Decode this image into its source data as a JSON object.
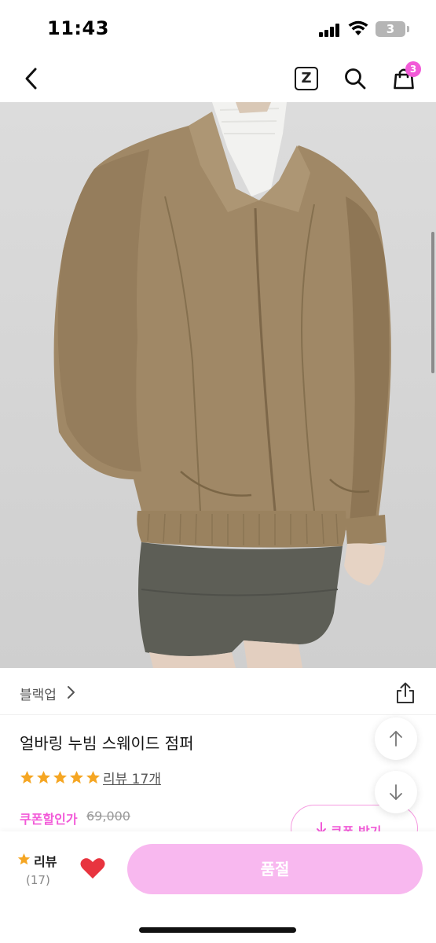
{
  "status_bar": {
    "time": "11:43",
    "battery": "3"
  },
  "nav": {
    "cart_count": "3",
    "zlogo_letter": "Z"
  },
  "brand": {
    "name": "블랙업"
  },
  "product": {
    "title": "얼바링 누빔 스웨이드 점퍼",
    "rating_stars": 5,
    "review_link": "리뷰 17개",
    "coupon_label": "쿠폰할인가",
    "original_price": "69,000",
    "coupon_button": "쿠폰 받기"
  },
  "bottom_bar": {
    "review_label": "리뷰",
    "review_count": "(17)",
    "buy_button": "품절"
  },
  "colors": {
    "accent": "#f25ad8",
    "buy_button": "#f8b8ef",
    "star": "#f5a623",
    "heart": "#e8343f"
  },
  "icons": [
    "back-icon",
    "zigzag-logo-icon",
    "search-icon",
    "cart-icon",
    "share-icon",
    "arrow-up-icon",
    "arrow-down-icon",
    "star-icon",
    "heart-icon",
    "download-icon"
  ]
}
